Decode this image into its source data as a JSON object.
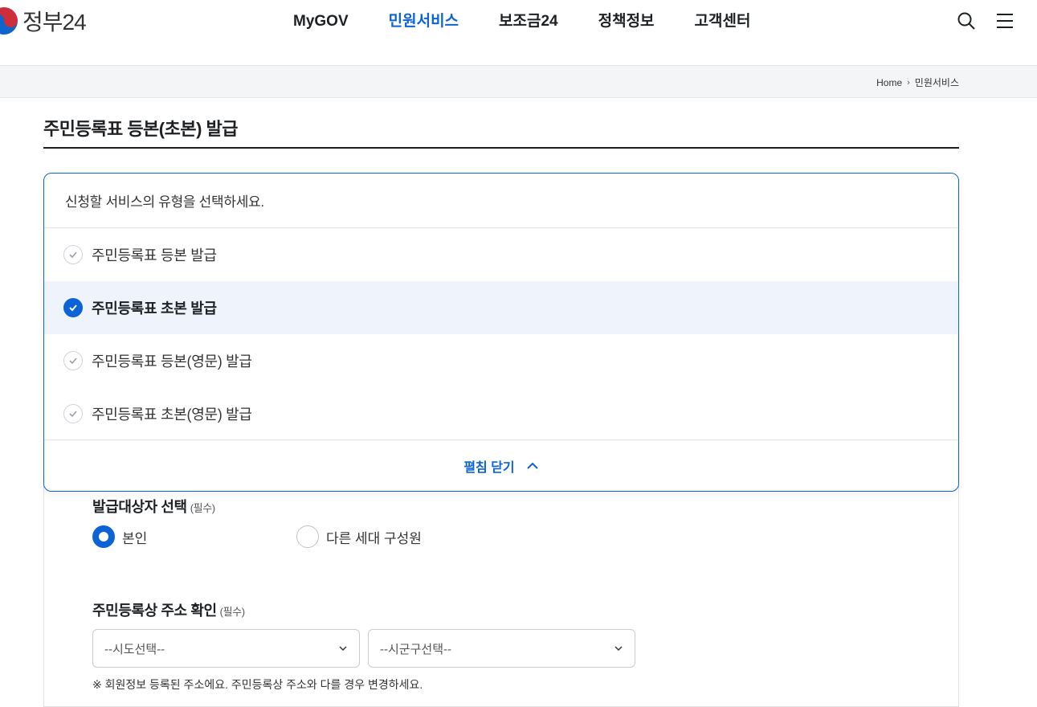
{
  "brand": {
    "name": "정부24"
  },
  "nav": [
    {
      "label": "MyGOV",
      "active": false
    },
    {
      "label": "민원서비스",
      "active": true
    },
    {
      "label": "보조금24",
      "active": false
    },
    {
      "label": "정책정보",
      "active": false
    },
    {
      "label": "고객센터",
      "active": false
    }
  ],
  "breadcrumb": {
    "home": "Home",
    "current": "민원서비스"
  },
  "page": {
    "title": "주민등록표 등본(초본) 발급"
  },
  "service_type": {
    "prompt": "신청할 서비스의 유형을 선택하세요.",
    "options": [
      {
        "label": "주민등록표 등본 발급",
        "selected": false
      },
      {
        "label": "주민등록표 초본 발급",
        "selected": true
      },
      {
        "label": "주민등록표 등본(영문) 발급",
        "selected": false
      },
      {
        "label": "주민등록표 초본(영문) 발급",
        "selected": false
      }
    ],
    "collapse_label": "펼침 닫기"
  },
  "target": {
    "label": "발급대상자 선택",
    "required": "(필수)",
    "options": [
      {
        "label": "본인",
        "selected": true
      },
      {
        "label": "다른 세대 구성원",
        "selected": false
      }
    ]
  },
  "address": {
    "label": "주민등록상 주소 확인",
    "required": "(필수)",
    "sido_placeholder": "--시도선택--",
    "sigungu_placeholder": "--시군구선택--",
    "notice": "※ 회원정보 등록된 주소에요. 주민등록상 주소와 다를 경우 변경하세요."
  },
  "colors": {
    "accent": "#0b63d6",
    "selected_bg": "#eef3fc",
    "text": "#1e2124"
  }
}
